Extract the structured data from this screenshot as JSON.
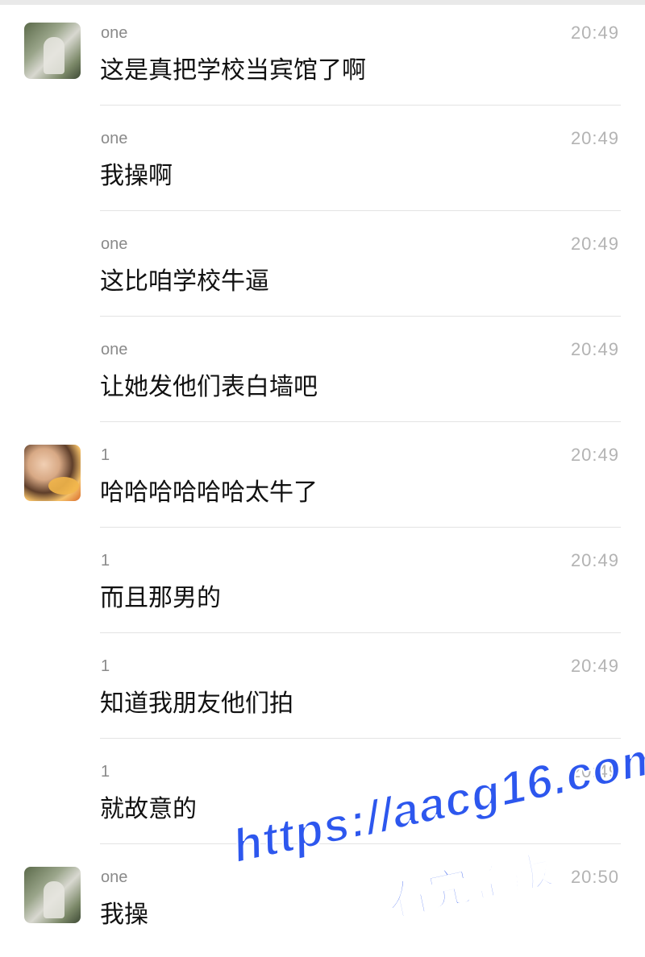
{
  "messages": [
    {
      "sender": "one",
      "time": "20:49",
      "text": "这是真把学校当宾馆了啊",
      "avatar": "one"
    },
    {
      "sender": "one",
      "time": "20:49",
      "text": "我操啊",
      "avatar": ""
    },
    {
      "sender": "one",
      "time": "20:49",
      "text": "这比咱学校牛逼",
      "avatar": ""
    },
    {
      "sender": "one",
      "time": "20:49",
      "text": "让她发他们表白墙吧",
      "avatar": ""
    },
    {
      "sender": "1",
      "time": "20:49",
      "text": "哈哈哈哈哈哈太牛了",
      "avatar": "kid"
    },
    {
      "sender": "1",
      "time": "20:49",
      "text": "而且那男的",
      "avatar": ""
    },
    {
      "sender": "1",
      "time": "20:49",
      "text": "知道我朋友他们拍",
      "avatar": ""
    },
    {
      "sender": "1",
      "time": "20:49",
      "text": "就故意的",
      "avatar": ""
    },
    {
      "sender": "one",
      "time": "20:50",
      "text": "我操",
      "avatar": "one"
    }
  ],
  "watermark": {
    "url": "https://aacg16.com",
    "subtitle": "看完整版"
  },
  "colors": {
    "watermark": "#2d57ee",
    "time": "#b3b3b3",
    "name": "#8a8a8a",
    "text": "#111111",
    "separator": "#e3e3e3"
  }
}
